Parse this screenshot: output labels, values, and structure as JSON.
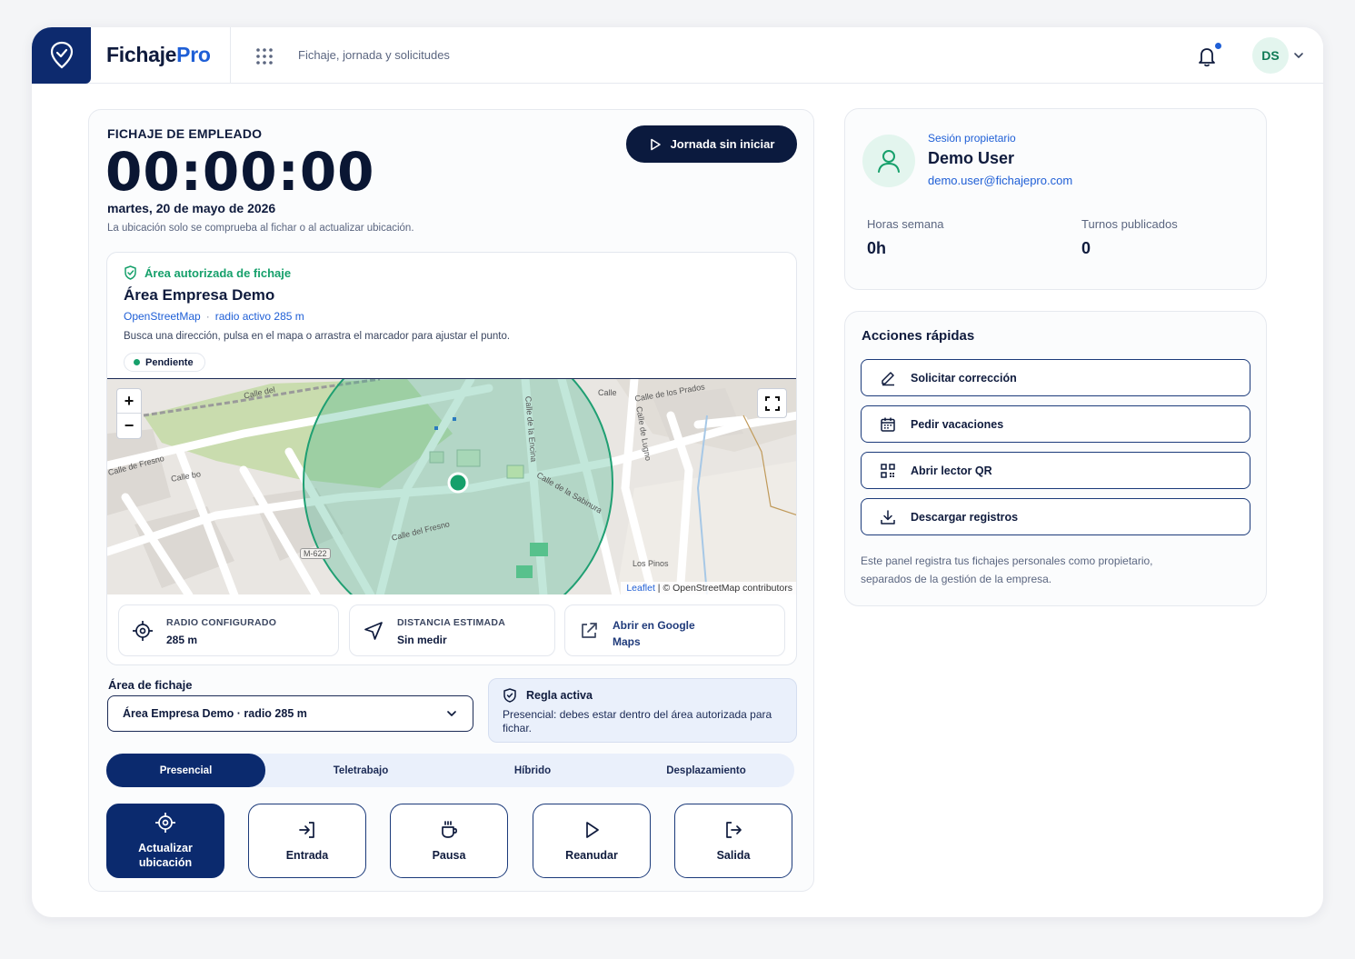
{
  "header": {
    "brand_part1": "Fichaje",
    "brand_part2": "Pro",
    "subtitle": "Fichaje, jornada y solicitudes",
    "avatar_initials": "DS"
  },
  "clock": {
    "eyebrow": "FICHAJE DE EMPLEADO",
    "timer": "00:00:00",
    "date": "martes, 20 de mayo de 2026",
    "location_note": "La ubicación solo se comprueba al fichar o al actualizar ubicación.",
    "start_button": "Jornada sin iniciar"
  },
  "area": {
    "tag": "Área autorizada de fichaje",
    "title": "Área Empresa Demo",
    "provider": "OpenStreetMap",
    "radius_text": "radio activo 285 m",
    "hint": "Busca una dirección, pulsa en el mapa o arrastra el marcador para ajustar el punto.",
    "status": "Pendiente"
  },
  "map": {
    "attribution_leaflet": "Leaflet",
    "attribution_rest": "| © OpenStreetMap contributors",
    "zoom_in": "+",
    "zoom_out": "−",
    "labels": [
      "Calle del",
      "Calle de los Prados",
      "Calle",
      "Calle bo",
      "Calle del Fresno",
      "Calle de la Sabinura",
      "Calle de Lugno",
      "Calle de la Encina",
      "M-622",
      "Los Pinos",
      "Calle de Fresno"
    ]
  },
  "stats": [
    {
      "label": "RADIO CONFIGURADO",
      "value": "285 m"
    },
    {
      "label": "DISTANCIA ESTIMADA",
      "value": "Sin medir"
    },
    {
      "label": "Abrir en Google Maps"
    }
  ],
  "area_select": {
    "label": "Área de fichaje",
    "selected": "Área Empresa Demo · radio 285 m"
  },
  "rule": {
    "title": "Regla activa",
    "description": "Presencial: debes estar dentro del área autorizada para fichar."
  },
  "modes": [
    "Presencial",
    "Teletrabajo",
    "Híbrido",
    "Desplazamiento"
  ],
  "active_mode": "Presencial",
  "actions": [
    "Actualizar ubicación",
    "Entrada",
    "Pausa",
    "Reanudar",
    "Salida"
  ],
  "profile": {
    "role": "Sesión propietario",
    "name": "Demo User",
    "email": "demo.user@fichajepro.com",
    "hours_label": "Horas semana",
    "hours_value": "0h",
    "shifts_label": "Turnos publicados",
    "shifts_value": "0"
  },
  "quick_actions": {
    "title": "Acciones rápidas",
    "items": [
      "Solicitar corrección",
      "Pedir vacaciones",
      "Abrir lector QR",
      "Descargar registros"
    ],
    "note": "Este panel registra tus fichajes personales como propietario, separados de la gestión de la empresa."
  },
  "colors": {
    "navy": "#0b2a6e",
    "accent_blue": "#1f5fd6",
    "success_green": "#16a06b"
  }
}
